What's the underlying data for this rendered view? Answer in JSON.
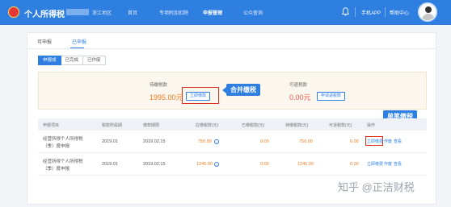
{
  "header": {
    "app_title": "个人所得税",
    "region_suffix": "浙江地区",
    "nav": [
      "首页",
      "专项附加扣除",
      "申报管理",
      "公众查询"
    ],
    "mobile_app_label": "手机APP",
    "help_label": "帮助中心",
    "accent_color": "#2f7fe1"
  },
  "tabs": [
    "可申报",
    "已申报"
  ],
  "subtabs": [
    "申报成",
    "已完成",
    "已作废"
  ],
  "summary": {
    "payable_label": "待缴税款",
    "payable_value": "1995.00元",
    "pay_all_button": "立即缴款",
    "refund_label": "可退税款",
    "refund_value": "0.00元",
    "refund_button": "申请退税款"
  },
  "annotations": {
    "merged_payment": "合并缴税",
    "single_payment": "单笔缴税"
  },
  "table": {
    "headers": [
      "申报项目",
      "税款所属期",
      "缴款期限",
      "应缴税款(元)",
      "已缴税款(元)",
      "待缴税款(元)",
      "可退税款(元)",
      "操作"
    ],
    "rows": [
      {
        "item_line1": "经营所得个人所得税",
        "item_line2": "（季）度申报",
        "period": "2019.01",
        "deadline": "2019.02.15",
        "due": "750.00",
        "paid": "0.00",
        "pending": "750.00",
        "refundable": "0.00",
        "op_pay": "立即缴费",
        "op_void": "作废",
        "op_view": "查看"
      },
      {
        "item_line1": "经营所得个人所得税",
        "item_line2": "（季）度申报",
        "period": "2019.01",
        "deadline": "2019.02.15",
        "due": "1245.00",
        "paid": "0.00",
        "pending": "1245.00",
        "refundable": "0.00",
        "op_pay": "立即缴费",
        "op_void": "作废",
        "op_view": "查看"
      }
    ]
  },
  "watermark": "知乎 @正洁财税"
}
